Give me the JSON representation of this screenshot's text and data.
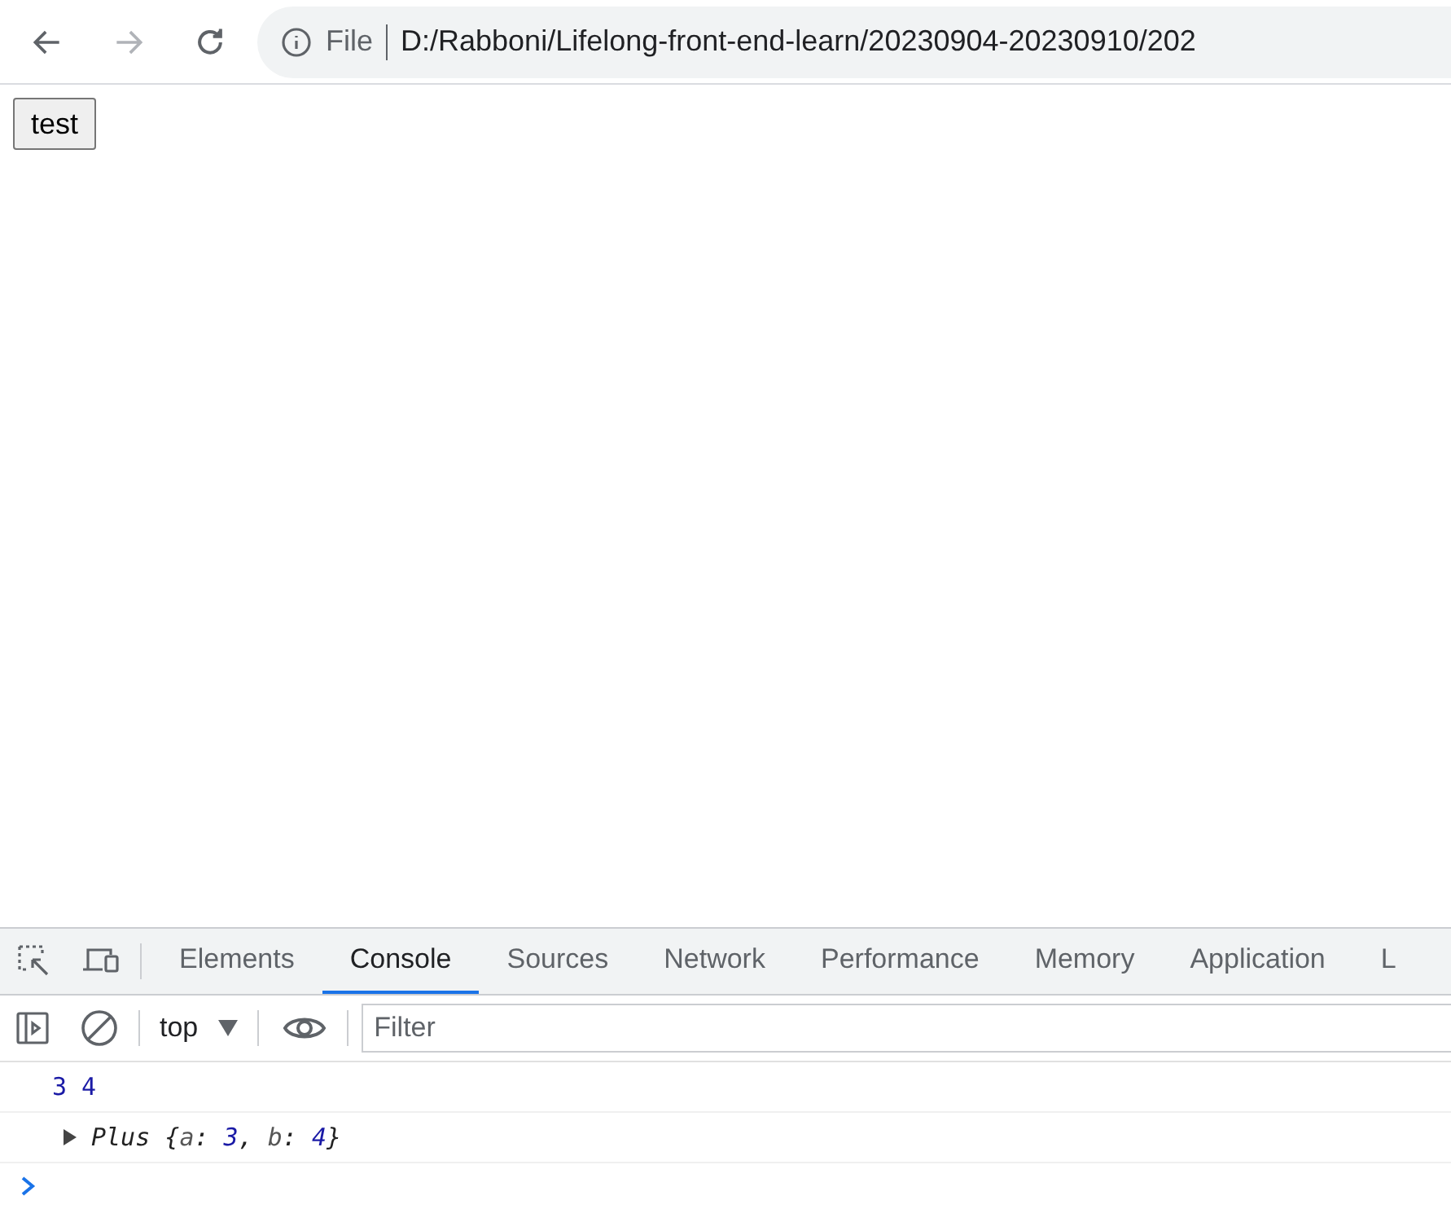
{
  "browser": {
    "back_disabled": false,
    "forward_disabled": true,
    "security_label": "File",
    "url": "D:/Rabboni/Lifelong-front-end-learn/20230904-20230910/202"
  },
  "page": {
    "button": "test"
  },
  "devtools": {
    "tabs": [
      {
        "label": "Elements",
        "selected": false
      },
      {
        "label": "Console",
        "selected": true
      },
      {
        "label": "Sources",
        "selected": false
      },
      {
        "label": "Network",
        "selected": false
      },
      {
        "label": "Performance",
        "selected": false
      },
      {
        "label": "Memory",
        "selected": false
      },
      {
        "label": "Application",
        "selected": false
      },
      {
        "label": "L",
        "selected": false
      }
    ],
    "context": "top",
    "filter_placeholder": "Filter",
    "logs": [
      {
        "kind": "values",
        "tokens": [
          {
            "text": "3",
            "kind": "number"
          },
          {
            "text": "4",
            "kind": "number"
          }
        ]
      },
      {
        "kind": "object",
        "expanded": false,
        "tokens": [
          {
            "text": "Plus {",
            "kind": "plain"
          },
          {
            "text": "a",
            "kind": "key"
          },
          {
            "text": ": ",
            "kind": "plain"
          },
          {
            "text": "3",
            "kind": "number"
          },
          {
            "text": ", ",
            "kind": "plain"
          },
          {
            "text": "b",
            "kind": "key"
          },
          {
            "text": ": ",
            "kind": "plain"
          },
          {
            "text": "4",
            "kind": "number"
          },
          {
            "text": "}",
            "kind": "plain"
          }
        ]
      }
    ]
  }
}
